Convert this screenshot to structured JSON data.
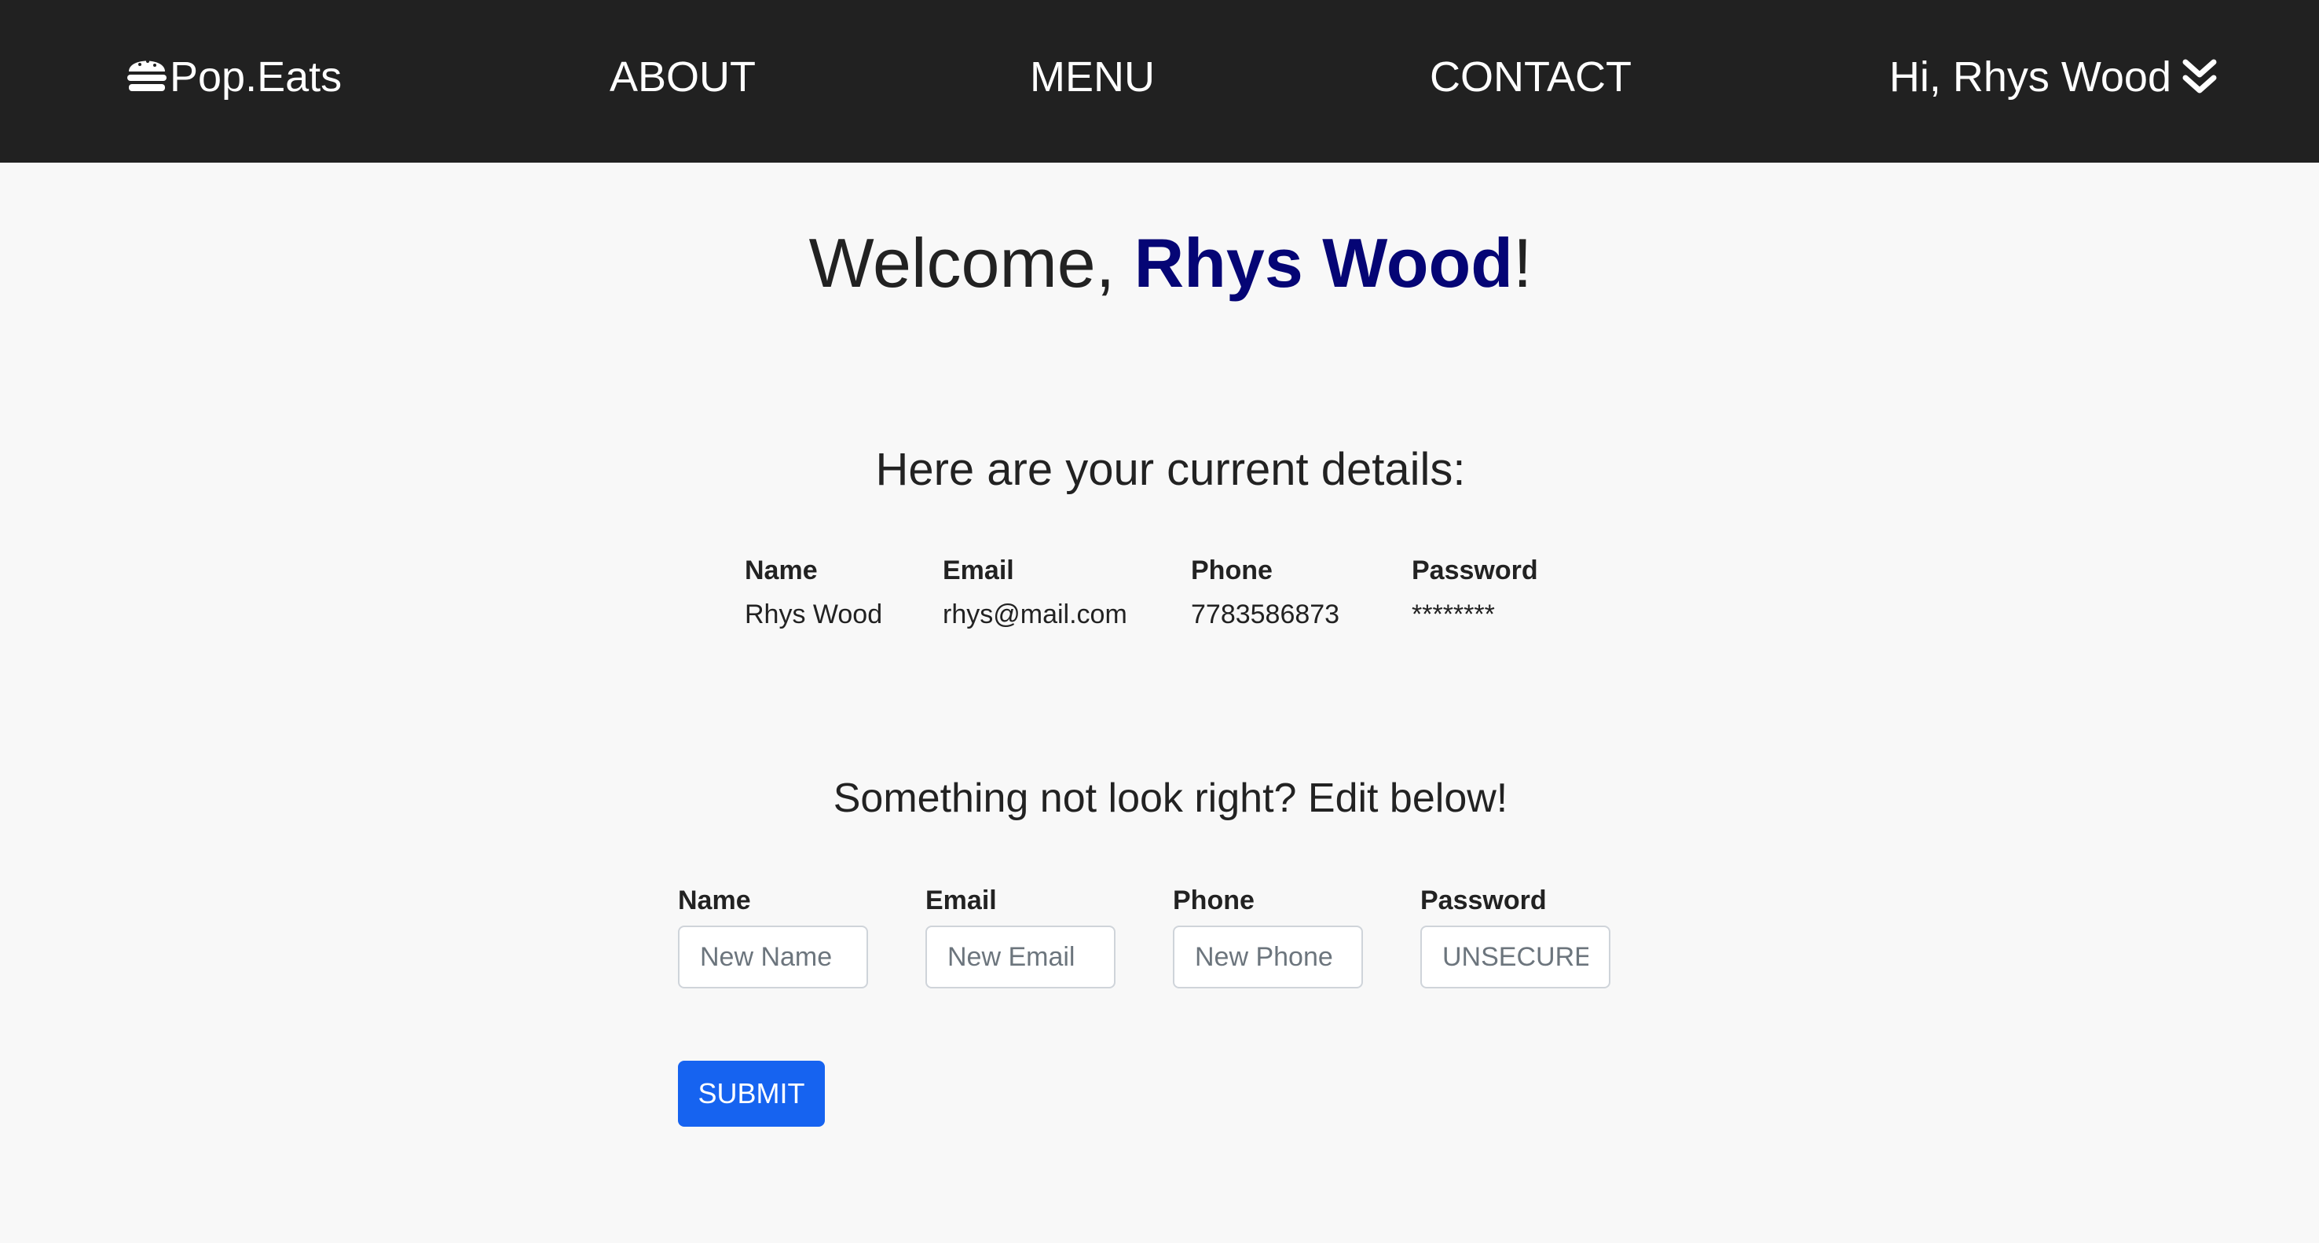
{
  "nav": {
    "brand": "Pop.Eats",
    "brand_icon": "burger-icon",
    "links": [
      "ABOUT",
      "MENU",
      "CONTACT"
    ],
    "user_greeting": "Hi, Rhys Wood",
    "user_menu_icon": "double-chevron-down-icon",
    "background": "#212121"
  },
  "welcome": {
    "prefix": "Welcome, ",
    "name": "Rhys Wood",
    "suffix": "!",
    "name_color": "#050575"
  },
  "details": {
    "heading": "Here are your current details:",
    "columns": [
      "Name",
      "Email",
      "Phone",
      "Password"
    ],
    "values": [
      "Rhys Wood",
      "rhys@mail.com",
      "7783586873",
      "********"
    ]
  },
  "edit": {
    "heading": "Something not look right? Edit below!",
    "fields": [
      {
        "label": "Name",
        "value": "",
        "placeholder": "New Name"
      },
      {
        "label": "Email",
        "value": "",
        "placeholder": "New Email"
      },
      {
        "label": "Phone",
        "value": "",
        "placeholder": "New Phone"
      },
      {
        "label": "Password",
        "value": "",
        "placeholder": "UNSECURE"
      }
    ],
    "submit_label": "SUBMIT",
    "submit_color": "#1663f0"
  }
}
